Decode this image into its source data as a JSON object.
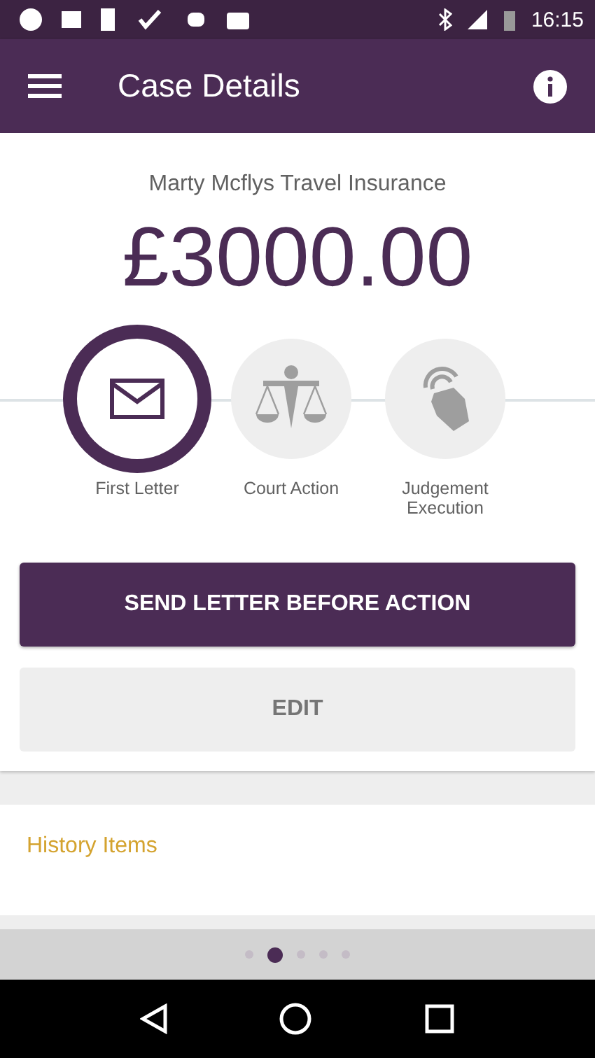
{
  "status_bar": {
    "time": "16:15"
  },
  "app_bar": {
    "title": "Case Details"
  },
  "case": {
    "name": "Marty Mcflys Travel Insurance",
    "amount": "£3000.00"
  },
  "steps": [
    {
      "kind": "letter",
      "label": "First Letter",
      "selected": true
    },
    {
      "kind": "court",
      "label": "Court Action",
      "selected": false
    },
    {
      "kind": "execution",
      "label": "Judgement Execution",
      "selected": false
    }
  ],
  "buttons": [
    {
      "kind": "primary",
      "label": "SEND LETTER BEFORE ACTION"
    },
    {
      "kind": "secondary",
      "label": "EDIT"
    }
  ],
  "history": {
    "title": "History Items"
  },
  "pager": [
    {
      "selected": false
    },
    {
      "selected": true
    },
    {
      "selected": false
    },
    {
      "selected": false
    },
    {
      "selected": false
    }
  ]
}
